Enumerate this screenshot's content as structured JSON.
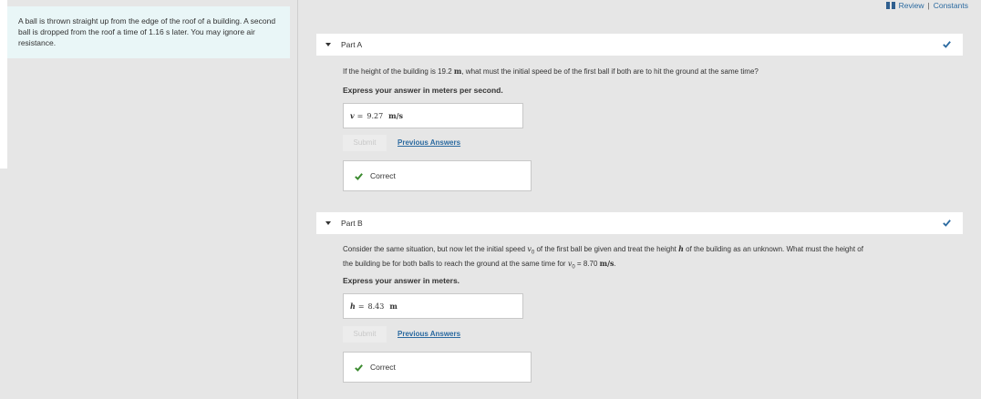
{
  "header": {
    "review_label": "Review",
    "separator": "|",
    "constants_label": "Constants"
  },
  "problem": {
    "text": "A ball is thrown straight up from the edge of the roof of a building. A second ball is dropped from the roof a time of 1.16 s later. You may ignore air resistance."
  },
  "parts": [
    {
      "title": "Part A",
      "question_pre": "If the height of the building is 19.2 ",
      "question_unit": "m",
      "question_post": ", what must the initial speed be of the first ball if both are to hit the ground at the same time?",
      "instruction": "Express your answer in meters per second.",
      "answer_var": "v",
      "answer_eq": "=",
      "answer_value": "9.27",
      "answer_unit": "m/s",
      "submit_label": "Submit",
      "previous_label": "Previous Answers",
      "result_label": "Correct"
    },
    {
      "title": "Part B",
      "question_line1_pre": "Consider the same situation, but now let the initial speed ",
      "question_v0": "v",
      "question_v0_sub": "0",
      "question_line1_mid": " of the first ball be given and treat the height ",
      "question_h": "h",
      "question_line1_post": " of the building as an unknown. What must the height of",
      "question_line2_pre": "the building be for both balls to reach the ground at the same time for ",
      "question_line2_eq": " = 8.70 ",
      "question_line2_unit": "m/s",
      "question_line2_post": ".",
      "instruction": "Express your answer in meters.",
      "answer_var": "h",
      "answer_eq": "=",
      "answer_value": "8.43",
      "answer_unit": "m",
      "submit_label": "Submit",
      "previous_label": "Previous Answers",
      "result_label": "Correct"
    }
  ],
  "colors": {
    "check_green": "#3a8a2e",
    "check_blue": "#2b6aa0",
    "link_blue": "#2b6aa0"
  }
}
